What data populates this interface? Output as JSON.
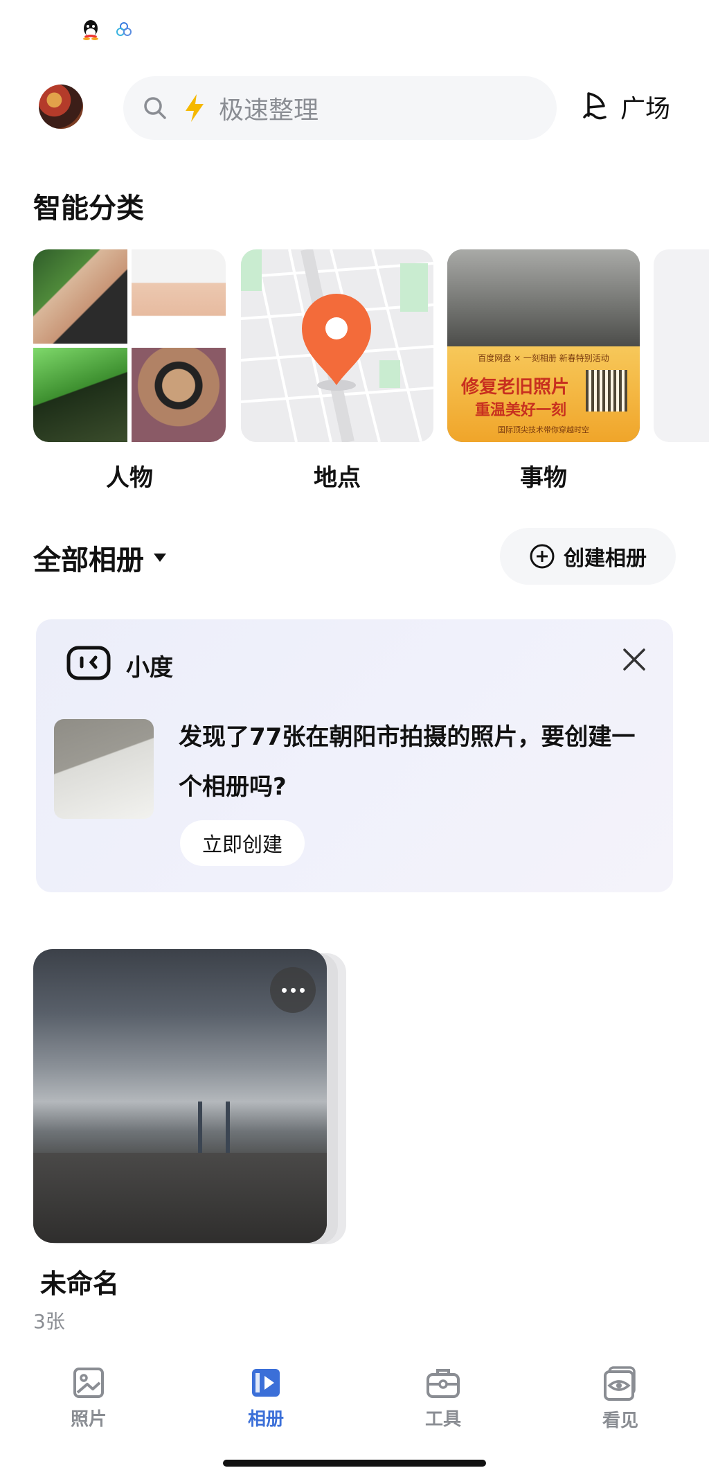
{
  "header": {
    "search_placeholder": "极速整理",
    "plaza_label": "广场"
  },
  "smart": {
    "title": "智能分类",
    "categories": [
      {
        "label": "人物"
      },
      {
        "label": "地点"
      },
      {
        "label": "事物"
      }
    ],
    "things_banner": {
      "top_text": "百度网盘 × 一刻相册 新春特别活动",
      "big_text": "修复老旧照片",
      "small_text": "重温美好一刻",
      "bottom_text": "国际顶尖技术带你穿越时空"
    }
  },
  "albums": {
    "title": "全部相册",
    "create_label": "创建相册",
    "items": [
      {
        "name": "未命名",
        "count": "3张"
      }
    ]
  },
  "xiaodu": {
    "name": "小度",
    "message": "发现了77张在朝阳市拍摄的照片，要创建一个相册吗?",
    "button": "立即创建"
  },
  "nav": {
    "items": [
      {
        "label": "照片"
      },
      {
        "label": "相册"
      },
      {
        "label": "工具"
      },
      {
        "label": "看见"
      }
    ],
    "active": "相册"
  },
  "colors": {
    "accent": "#3b6fd8",
    "muted": "#8a8d93",
    "search_bg": "#f5f6f8",
    "bolt": "#f5b800",
    "map_pin": "#f36b3a"
  }
}
